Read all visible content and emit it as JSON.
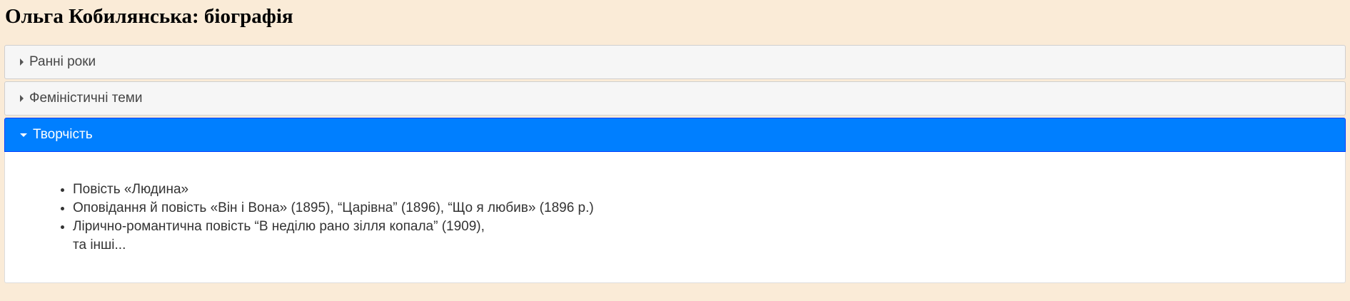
{
  "page": {
    "title": "Ольга Кобилянська: біографія"
  },
  "accordion": {
    "sections": [
      {
        "label": "Ранні роки",
        "expanded": false
      },
      {
        "label": "Феміністичні теми",
        "expanded": false
      },
      {
        "label": "Творчість",
        "expanded": true
      }
    ],
    "active_panel": {
      "items": [
        "Повість «Людина»",
        "Оповідання й повість «Він і Вона» (1895), “Царівна” (1896), “Що я любив» (1896 р.)",
        "Лірично-романтична повість “В неділю рано зілля копала” (1909),"
      ],
      "trailing_text": "та інші..."
    }
  },
  "colors": {
    "background": "#faebd7",
    "active_header": "#007fff",
    "inactive_header": "#f6f6f6"
  },
  "icons": {
    "collapsed": "triangle-right-icon",
    "expanded": "triangle-down-icon"
  }
}
